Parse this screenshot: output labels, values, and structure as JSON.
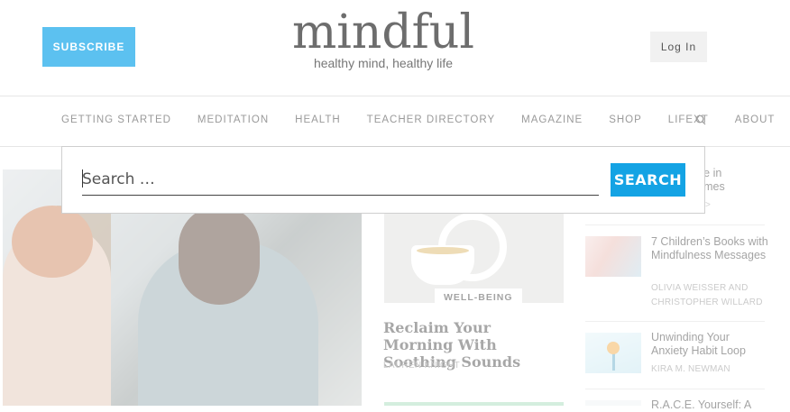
{
  "header": {
    "subscribe_label": "SUBSCRIBE",
    "logo_word": "mindful",
    "logo_tagline": "healthy mind, healthy life",
    "login_label": "Log In"
  },
  "nav": {
    "items": [
      "GETTING STARTED",
      "MEDITATION",
      "HEALTH",
      "TEACHER DIRECTORY",
      "MAGAZINE",
      "SHOP",
      "LIFEXT",
      "ABOUT"
    ],
    "search_icon": "search-icon"
  },
  "search": {
    "placeholder": "Search …",
    "button_label": "SEARCH"
  },
  "featured_card": {
    "tag": "WELL-BEING",
    "title": "Reclaim Your Morning With Soothing Sounds",
    "author": "LAUREN KNIGHT"
  },
  "sidebar": {
    "partial_title_1": "ence in",
    "partial_title_2": "g Times",
    "partial_arrow": ">",
    "items": [
      {
        "title": "7 Children’s Books with Mindfulness Messages",
        "author": "OLIVIA WEISSER AND CHRISTOPHER WILLARD"
      },
      {
        "title": "Unwinding Your Anxiety Habit Loop",
        "author": "KIRA M. NEWMAN"
      },
      {
        "title": "R.A.C.E. Yourself: A"
      }
    ]
  },
  "colors": {
    "subscribe_bg": "#5cc1f0",
    "search_button_bg": "#14a3e4",
    "login_bg": "#f1f1f1"
  }
}
